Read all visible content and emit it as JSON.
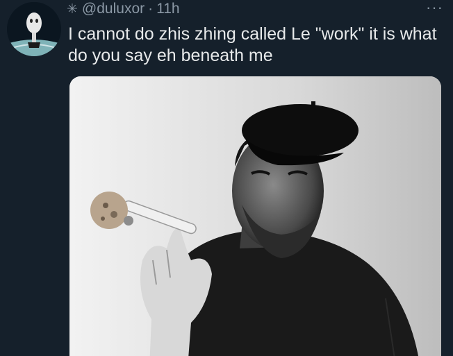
{
  "tweet": {
    "author_handle": "@duluxor",
    "separator": "·",
    "time": "11h",
    "text": "I cannot do zhis zhing called Le \"work\" it is what do you say eh beneath me",
    "more_icon": "more-dots-icon",
    "sparkle_icon": "sparkle-icon"
  },
  "colors": {
    "background": "#15202b",
    "text": "#e7e9ea",
    "muted": "#8b98a5"
  }
}
